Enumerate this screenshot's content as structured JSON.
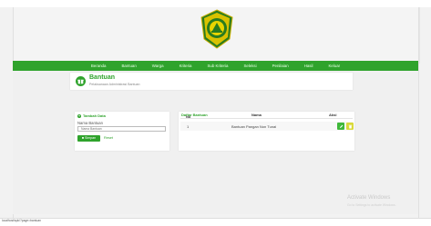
{
  "nav": {
    "items": [
      "Beranda",
      "Bantuan",
      "Warga",
      "Kriteria",
      "Sub Kriteria",
      "Seleksi",
      "Penilaian",
      "Hasil",
      "Keluar"
    ]
  },
  "page": {
    "title": "Bantuan",
    "subtitle": "Pelaksanaan Administrasi Bantuan"
  },
  "form": {
    "header": "Tambah Data",
    "field_label": "Nama Bantuan",
    "field_placeholder": "Nama Bantuan",
    "save_label": "Simpan",
    "reset_label": "Reset"
  },
  "list": {
    "header": "Daftar Bantuan",
    "columns": [
      "No",
      "Nama",
      "Aksi"
    ],
    "rows": [
      {
        "no": "1",
        "nama": "Bantuan Pangan Non Tunai"
      }
    ]
  },
  "status_bar": {
    "url": "localhost/spk/?page=bantuan"
  },
  "watermark": {
    "line1": "Activate Windows",
    "line2": "Go to Settings to activate Windows."
  },
  "colors": {
    "primary": "#2fa32c",
    "edit": "#3fb83a",
    "delete": "#d9d93a"
  }
}
